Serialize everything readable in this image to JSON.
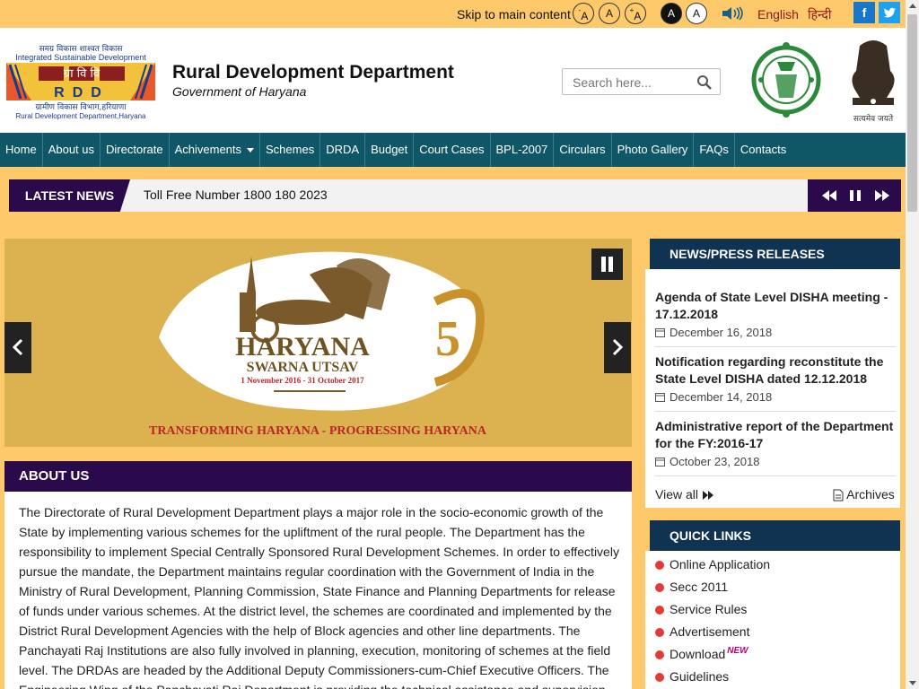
{
  "topbar": {
    "skip": "Skip to main content",
    "font_decrease": "A",
    "font_normal": "A",
    "font_increase": "A",
    "contrast_dark": "A",
    "contrast_light": "A",
    "speaker_icon": "screen-reader-icon",
    "lang_english": "English",
    "lang_hindi": "हिन्दी",
    "facebook": "f",
    "twitter_icon": "twitter-icon"
  },
  "header": {
    "logo_text_top": "समग्र विकास शाश्वत विकास",
    "logo_text_en": "Integrated Sustainable Development",
    "logo_letters_hi": "ग्रा वि वि",
    "logo_letters_en": "RDD",
    "logo_text_bottom_hi": "ग्रामीण विकास विभाग,हरियाणा",
    "logo_text_bottom_en": "Rural Development Department,Haryana",
    "title": "Rural Development Department",
    "subtitle": "Government  of Haryana",
    "search_placeholder": "Search here...",
    "emblem2_caption": "सत्यमेव जयते"
  },
  "nav": {
    "items": [
      "Home",
      "About us",
      "Directorate",
      "Achivements",
      "Schemes",
      "DRDA",
      "Budget",
      "Court Cases",
      "BPL-2007",
      "Circulars",
      "Photo Gallery",
      "FAQs",
      "Contacts"
    ]
  },
  "news": {
    "label": "LATEST NEWS",
    "text": "Toll Free Number 1800 180 2023"
  },
  "slider": {
    "line1": "HARYANA",
    "line2": "SWARNA UTSAV",
    "dates": "1 November 2016 - 31 October 2017",
    "tagline": "TRANSFORMING HARYANA - PROGRESSING HARYANA"
  },
  "about": {
    "heading": "ABOUT US",
    "body": "The Directorate of Rural Development Department plays a major role in the socio-economic growth of the State by implementing various schemes for the upliftment of the rural people. The Department has the responsibility to implement Special Centrally Sponsored Rural Development Schemes. In order to effectively pursue the mandate, the Department maintains regular coordination with the Government of India in the Ministry of Rural Development, Planning Commission, State Finance and Planning Departments for release of funds under various schemes. At the district level, the schemes are coordinated and implemented by the District Rural Development Agencies with the help of Block agencies and other line departments. The Panchayati Raj Institutions are also fully involved in planning, execution, monitoring of schemes at the field level. The DRDAs are headed by the Additional Deputy Commissioners-cum-Chief Executive Officers. The Engineering Wing of the Panchayati Raj Department is providing the technical assistance and supervision"
  },
  "press": {
    "heading": "NEWS/PRESS RELEASES",
    "items": [
      {
        "title": "Agenda of State Level DISHA meeting - 17.12.2018",
        "date": "December 16, 2018"
      },
      {
        "title": "Notification regarding reconstitute the State Level DISHA dated 12.12.2018",
        "date": "December 14, 2018"
      },
      {
        "title": "Administrative report of the Department for the FY:2016-17",
        "date": "October 23, 2018"
      }
    ],
    "view_all": "View all",
    "archives": "Archives"
  },
  "quick": {
    "heading": "QUICK LINKS",
    "items": [
      "Online Application",
      "Secc 2011",
      "Service Rules",
      "Advertisement",
      "Download",
      "Guidelines"
    ],
    "new_badge": "NEW"
  }
}
